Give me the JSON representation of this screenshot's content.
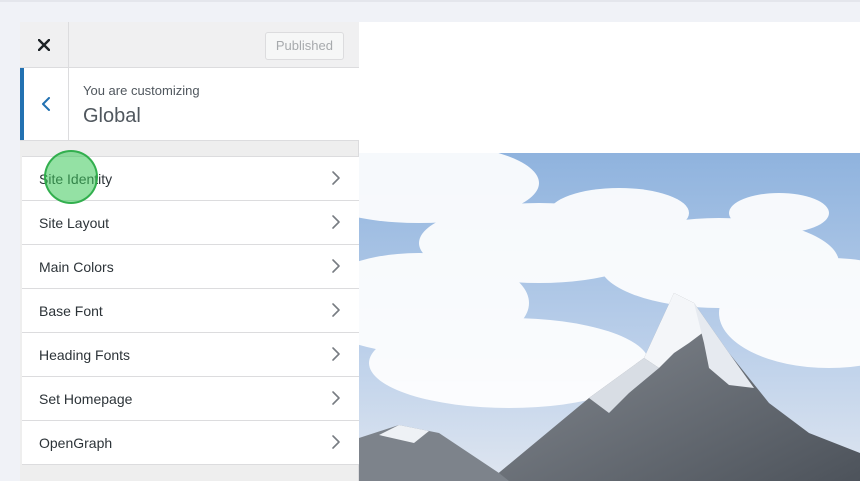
{
  "header": {
    "close_icon": "close-icon",
    "publish_label": "Published"
  },
  "customizing": {
    "label": "You are customizing",
    "title": "Global",
    "back_icon": "chevron-left-icon"
  },
  "sections": [
    {
      "label": "Site Identity"
    },
    {
      "label": "Site Layout"
    },
    {
      "label": "Main Colors"
    },
    {
      "label": "Base Font"
    },
    {
      "label": "Heading Fonts"
    },
    {
      "label": "Set Homepage"
    },
    {
      "label": "OpenGraph"
    }
  ],
  "colors": {
    "accent": "#2271b1",
    "panel_bg": "#eeeeee",
    "sky": "#8fb3de",
    "highlight": "#3cc85a"
  }
}
